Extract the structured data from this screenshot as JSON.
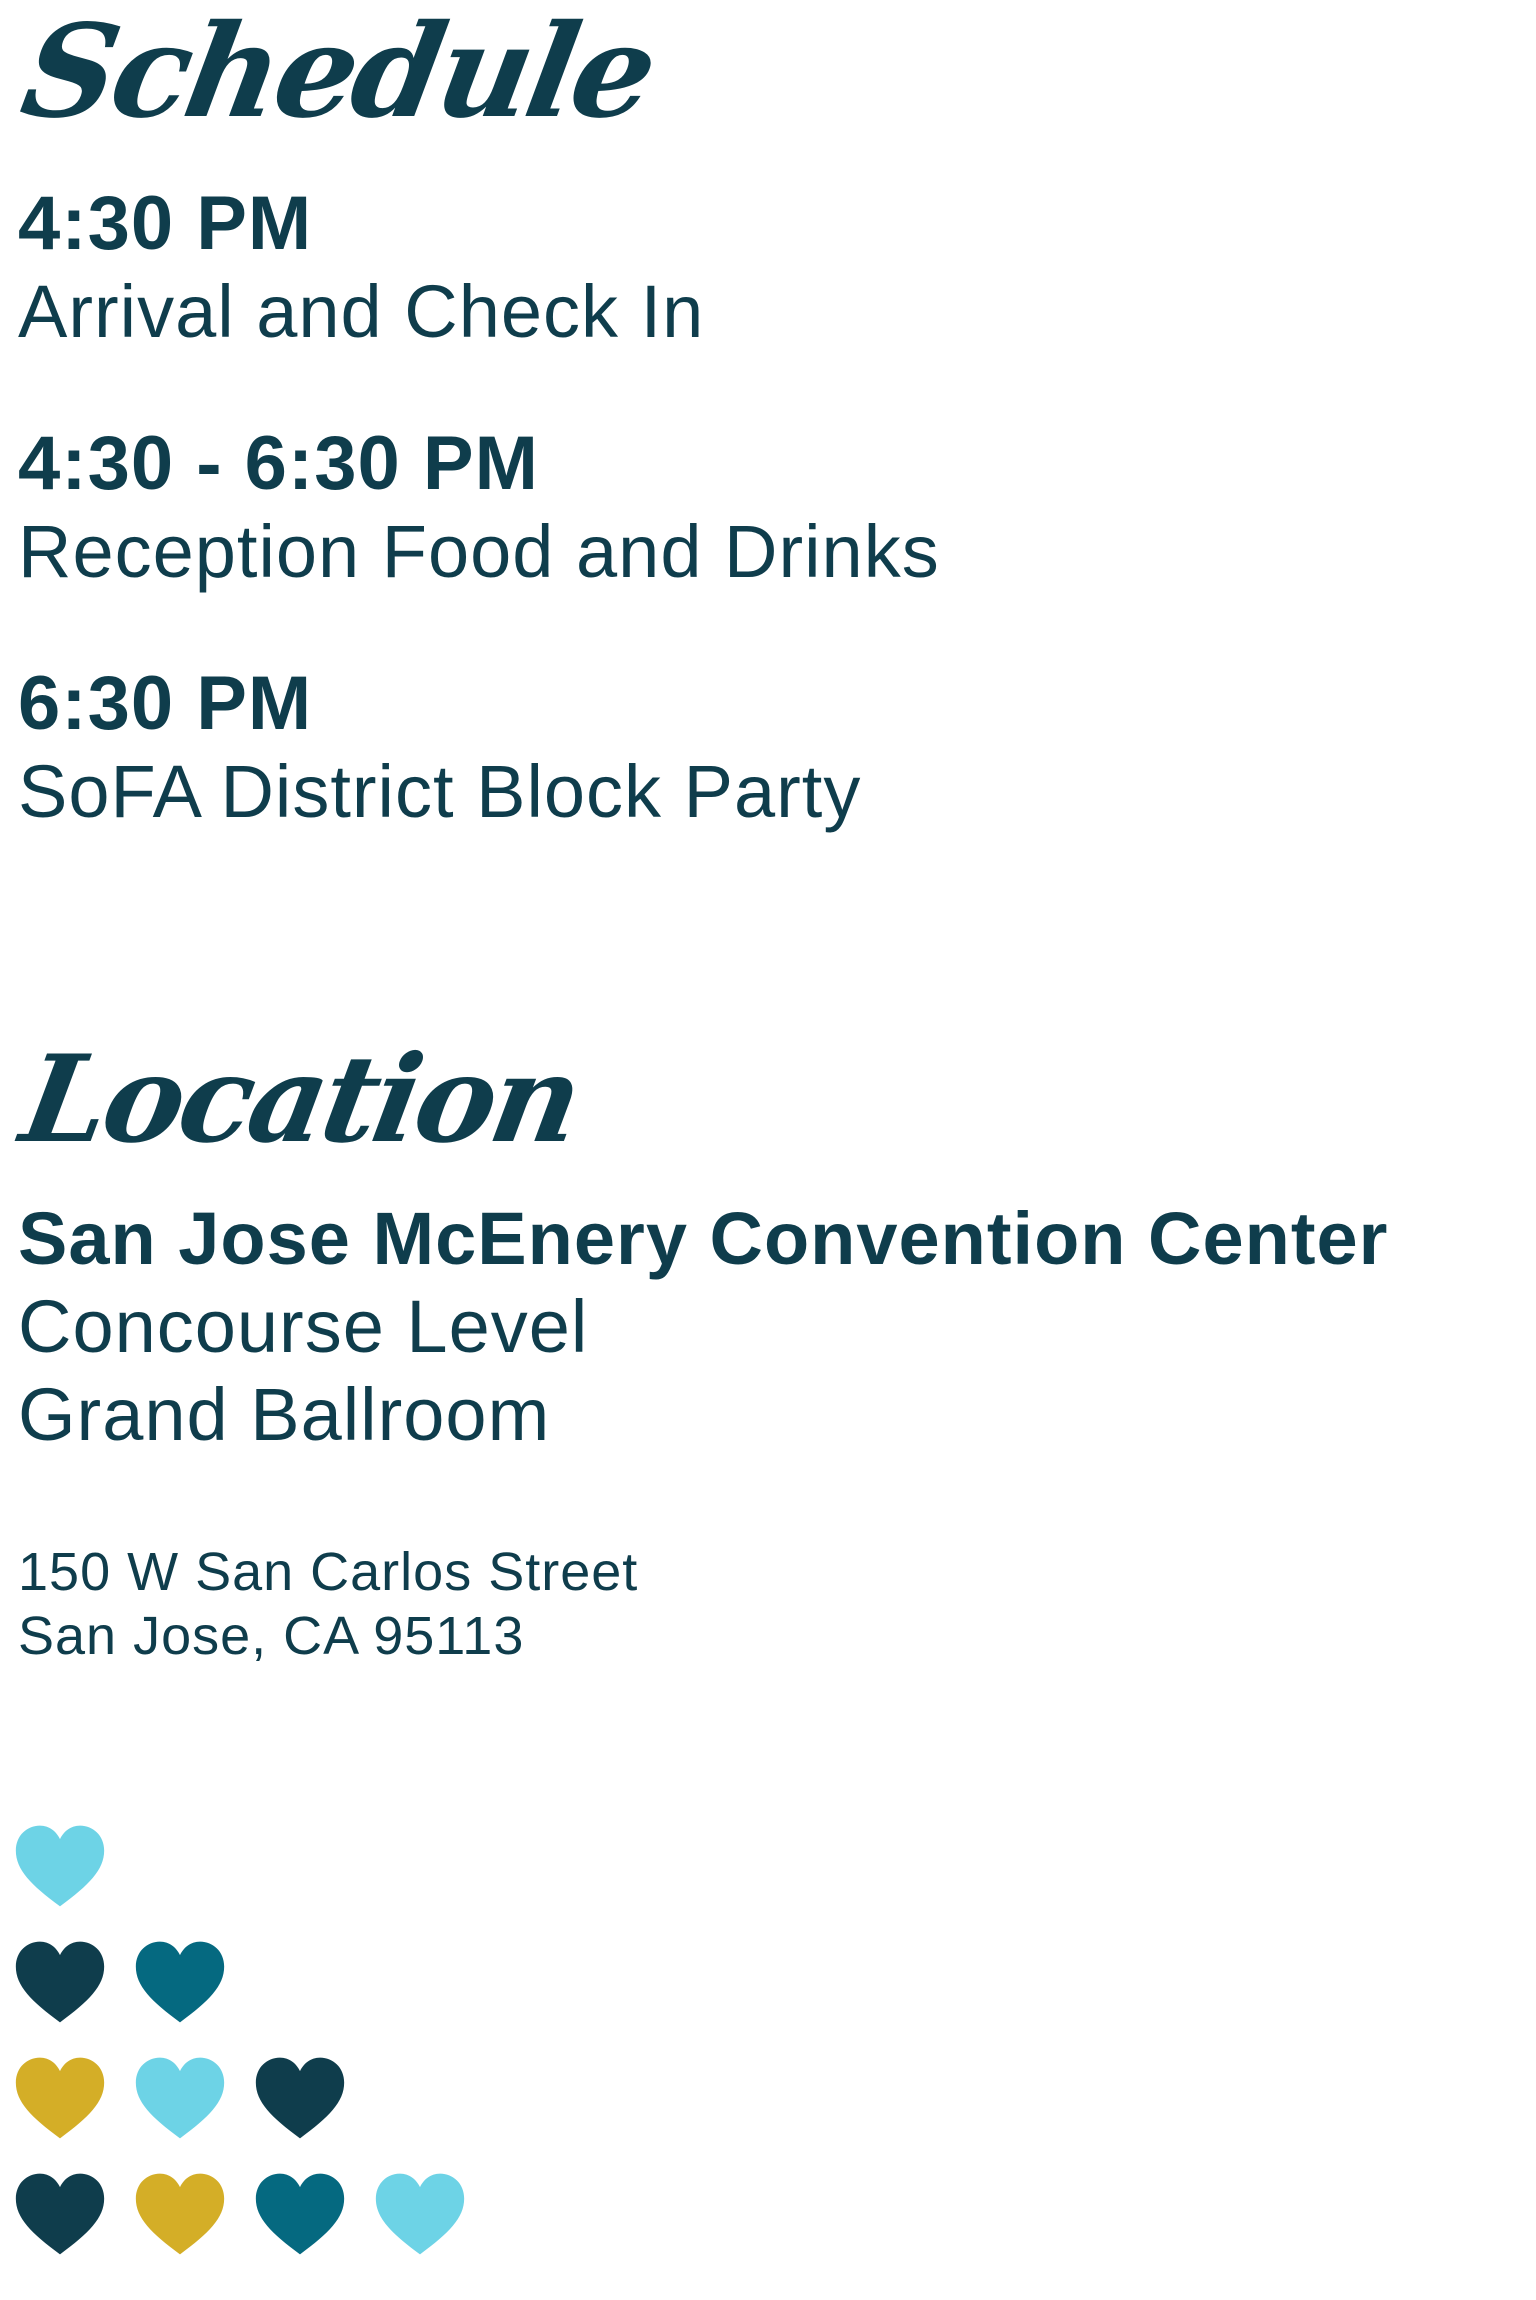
{
  "schedule": {
    "heading": "Schedule",
    "items": [
      {
        "time": "4:30 PM",
        "description": "Arrival and Check In"
      },
      {
        "time": "4:30 - 6:30 PM",
        "description": "Reception Food and Drinks"
      },
      {
        "time": "6:30 PM",
        "description": "SoFA District Block Party"
      }
    ]
  },
  "location": {
    "heading": "Location",
    "venue": "San Jose McEnery Convention Center",
    "level": "Concourse Level",
    "room": "Grand Ballroom",
    "address_line_1": "150 W San Carlos Street",
    "address_line_2": "San Jose, CA 95113"
  },
  "colors": {
    "text": "#0f3d4c",
    "light_blue": "#6dd3e6",
    "dark_navy": "#0f3d4c",
    "teal": "#056980",
    "gold": "#d4ae27"
  },
  "hearts": [
    [
      "light_blue"
    ],
    [
      "dark_navy",
      "teal"
    ],
    [
      "gold",
      "light_blue",
      "dark_navy"
    ],
    [
      "dark_navy",
      "gold",
      "teal",
      "light_blue"
    ]
  ]
}
